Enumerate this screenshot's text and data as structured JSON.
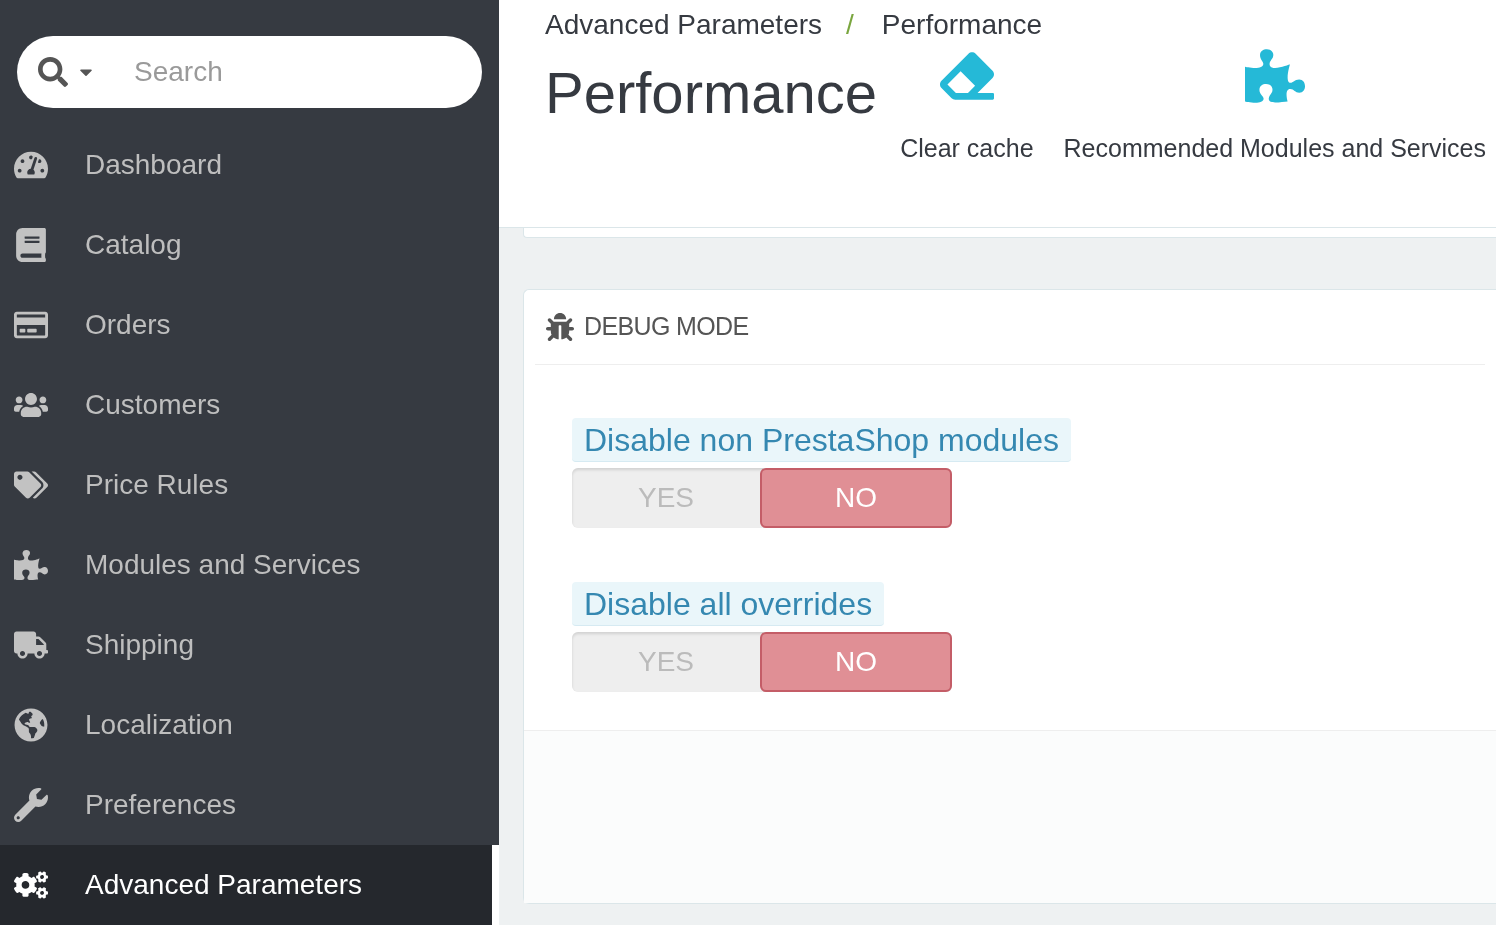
{
  "sidebar": {
    "search": {
      "placeholder": "Search"
    },
    "items": [
      {
        "label": "Dashboard",
        "selected": false
      },
      {
        "label": "Catalog",
        "selected": false
      },
      {
        "label": "Orders",
        "selected": false
      },
      {
        "label": "Customers",
        "selected": false
      },
      {
        "label": "Price Rules",
        "selected": false
      },
      {
        "label": "Modules and Services",
        "selected": false
      },
      {
        "label": "Shipping",
        "selected": false
      },
      {
        "label": "Localization",
        "selected": false
      },
      {
        "label": "Preferences",
        "selected": false
      },
      {
        "label": "Advanced Parameters",
        "selected": true
      }
    ]
  },
  "header": {
    "breadcrumb": {
      "items": [
        "Advanced Parameters",
        "Performance"
      ],
      "separator": "/"
    },
    "title": "Performance",
    "toolbar": [
      "Clear cache",
      "Recommended Modules and Services"
    ]
  },
  "panel": {
    "title": "DEBUG MODE",
    "settings": [
      {
        "label": "Disable non PrestaShop modules",
        "options": [
          {
            "label": "YES",
            "selected": false
          },
          {
            "label": "NO",
            "selected": true
          }
        ]
      },
      {
        "label": "Disable all overrides",
        "options": [
          {
            "label": "YES",
            "selected": false
          },
          {
            "label": "NO",
            "selected": true
          }
        ]
      }
    ]
  }
}
